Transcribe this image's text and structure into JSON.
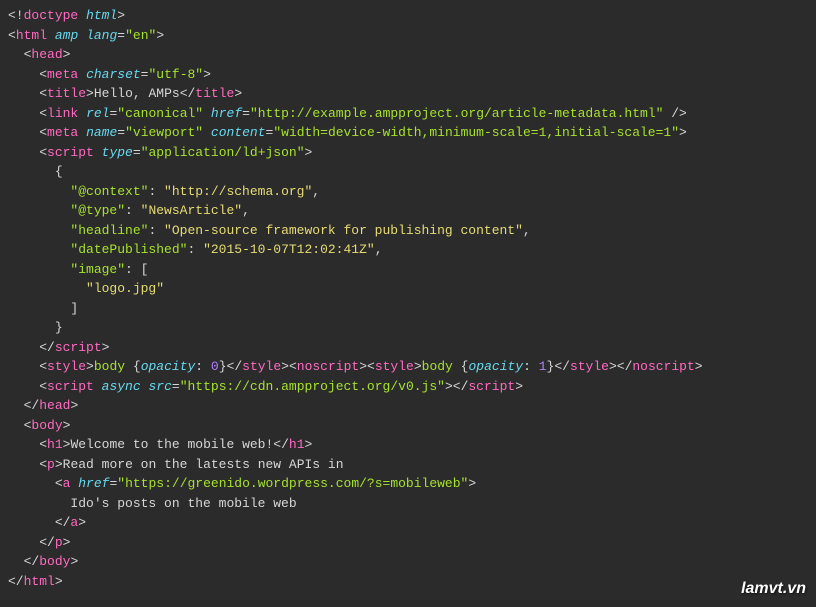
{
  "lines": [
    {
      "indent": 0,
      "segments": [
        {
          "t": "<!",
          "c": "tag-bracket"
        },
        {
          "t": "doctype",
          "c": "doctype"
        },
        {
          "t": " ",
          "c": "text-content"
        },
        {
          "t": "html",
          "c": "attr-name"
        },
        {
          "t": ">",
          "c": "tag-bracket"
        }
      ]
    },
    {
      "indent": 0,
      "segments": [
        {
          "t": "<",
          "c": "tag-bracket"
        },
        {
          "t": "html",
          "c": "tag-name"
        },
        {
          "t": " ",
          "c": "text-content"
        },
        {
          "t": "amp",
          "c": "attr-name"
        },
        {
          "t": " ",
          "c": "text-content"
        },
        {
          "t": "lang",
          "c": "attr-name"
        },
        {
          "t": "=",
          "c": "equals"
        },
        {
          "t": "\"en\"",
          "c": "attr-value"
        },
        {
          "t": ">",
          "c": "tag-bracket"
        }
      ]
    },
    {
      "indent": 1,
      "segments": [
        {
          "t": "<",
          "c": "tag-bracket"
        },
        {
          "t": "head",
          "c": "tag-name"
        },
        {
          "t": ">",
          "c": "tag-bracket"
        }
      ]
    },
    {
      "indent": 2,
      "segments": [
        {
          "t": "<",
          "c": "tag-bracket"
        },
        {
          "t": "meta",
          "c": "tag-name"
        },
        {
          "t": " ",
          "c": "text-content"
        },
        {
          "t": "charset",
          "c": "attr-name"
        },
        {
          "t": "=",
          "c": "equals"
        },
        {
          "t": "\"utf-8\"",
          "c": "attr-value"
        },
        {
          "t": ">",
          "c": "tag-bracket"
        }
      ]
    },
    {
      "indent": 2,
      "segments": [
        {
          "t": "<",
          "c": "tag-bracket"
        },
        {
          "t": "title",
          "c": "tag-name"
        },
        {
          "t": ">",
          "c": "tag-bracket"
        },
        {
          "t": "Hello, AMPs",
          "c": "text-content"
        },
        {
          "t": "</",
          "c": "tag-bracket"
        },
        {
          "t": "title",
          "c": "tag-name"
        },
        {
          "t": ">",
          "c": "tag-bracket"
        }
      ]
    },
    {
      "indent": 2,
      "segments": [
        {
          "t": "<",
          "c": "tag-bracket"
        },
        {
          "t": "link",
          "c": "tag-name"
        },
        {
          "t": " ",
          "c": "text-content"
        },
        {
          "t": "rel",
          "c": "attr-name"
        },
        {
          "t": "=",
          "c": "equals"
        },
        {
          "t": "\"canonical\"",
          "c": "attr-value"
        },
        {
          "t": " ",
          "c": "text-content"
        },
        {
          "t": "href",
          "c": "attr-name"
        },
        {
          "t": "=",
          "c": "equals"
        },
        {
          "t": "\"http://example.ampproject.org/article-metadata.html\"",
          "c": "attr-value"
        },
        {
          "t": " />",
          "c": "tag-bracket"
        }
      ]
    },
    {
      "indent": 2,
      "segments": [
        {
          "t": "<",
          "c": "tag-bracket"
        },
        {
          "t": "meta",
          "c": "tag-name"
        },
        {
          "t": " ",
          "c": "text-content"
        },
        {
          "t": "name",
          "c": "attr-name"
        },
        {
          "t": "=",
          "c": "equals"
        },
        {
          "t": "\"viewport\"",
          "c": "attr-value"
        },
        {
          "t": " ",
          "c": "text-content"
        },
        {
          "t": "content",
          "c": "attr-name"
        },
        {
          "t": "=",
          "c": "equals"
        },
        {
          "t": "\"width=device-width,minimum-scale=1,initial-scale=1\"",
          "c": "attr-value"
        },
        {
          "t": ">",
          "c": "tag-bracket"
        }
      ]
    },
    {
      "indent": 2,
      "segments": [
        {
          "t": "<",
          "c": "tag-bracket"
        },
        {
          "t": "script",
          "c": "tag-name"
        },
        {
          "t": " ",
          "c": "text-content"
        },
        {
          "t": "type",
          "c": "attr-name"
        },
        {
          "t": "=",
          "c": "equals"
        },
        {
          "t": "\"application/ld+json\"",
          "c": "attr-value"
        },
        {
          "t": ">",
          "c": "tag-bracket"
        }
      ]
    },
    {
      "indent": 3,
      "segments": [
        {
          "t": "{",
          "c": "json-punct"
        }
      ]
    },
    {
      "indent": 4,
      "segments": [
        {
          "t": "\"@context\"",
          "c": "json-key"
        },
        {
          "t": ": ",
          "c": "json-punct"
        },
        {
          "t": "\"http://schema.org\"",
          "c": "json-string"
        },
        {
          "t": ",",
          "c": "json-punct"
        }
      ]
    },
    {
      "indent": 4,
      "segments": [
        {
          "t": "\"@type\"",
          "c": "json-key"
        },
        {
          "t": ": ",
          "c": "json-punct"
        },
        {
          "t": "\"NewsArticle\"",
          "c": "json-string"
        },
        {
          "t": ",",
          "c": "json-punct"
        }
      ]
    },
    {
      "indent": 4,
      "segments": [
        {
          "t": "\"headline\"",
          "c": "json-key"
        },
        {
          "t": ": ",
          "c": "json-punct"
        },
        {
          "t": "\"Open-source framework for publishing content\"",
          "c": "json-string"
        },
        {
          "t": ",",
          "c": "json-punct"
        }
      ]
    },
    {
      "indent": 4,
      "segments": [
        {
          "t": "\"datePublished\"",
          "c": "json-key"
        },
        {
          "t": ": ",
          "c": "json-punct"
        },
        {
          "t": "\"2015-10-07T12:02:41Z\"",
          "c": "json-string"
        },
        {
          "t": ",",
          "c": "json-punct"
        }
      ]
    },
    {
      "indent": 4,
      "segments": [
        {
          "t": "\"image\"",
          "c": "json-key"
        },
        {
          "t": ": [",
          "c": "json-punct"
        }
      ]
    },
    {
      "indent": 5,
      "segments": [
        {
          "t": "\"logo.jpg\"",
          "c": "json-string"
        }
      ]
    },
    {
      "indent": 4,
      "segments": [
        {
          "t": "]",
          "c": "json-punct"
        }
      ]
    },
    {
      "indent": 3,
      "segments": [
        {
          "t": "}",
          "c": "json-punct"
        }
      ]
    },
    {
      "indent": 2,
      "segments": [
        {
          "t": "</",
          "c": "tag-bracket"
        },
        {
          "t": "script",
          "c": "tag-name"
        },
        {
          "t": ">",
          "c": "tag-bracket"
        }
      ]
    },
    {
      "indent": 2,
      "segments": [
        {
          "t": "<",
          "c": "tag-bracket"
        },
        {
          "t": "style",
          "c": "tag-name"
        },
        {
          "t": ">",
          "c": "tag-bracket"
        },
        {
          "t": "body ",
          "c": "css-selector"
        },
        {
          "t": "{",
          "c": "css-brace"
        },
        {
          "t": "opacity",
          "c": "css-prop"
        },
        {
          "t": ": ",
          "c": "css-value"
        },
        {
          "t": "0",
          "c": "css-num"
        },
        {
          "t": "}",
          "c": "css-brace"
        },
        {
          "t": "</",
          "c": "tag-bracket"
        },
        {
          "t": "style",
          "c": "tag-name"
        },
        {
          "t": ">",
          "c": "tag-bracket"
        },
        {
          "t": "<",
          "c": "tag-bracket"
        },
        {
          "t": "noscript",
          "c": "tag-name"
        },
        {
          "t": ">",
          "c": "tag-bracket"
        },
        {
          "t": "<",
          "c": "tag-bracket"
        },
        {
          "t": "style",
          "c": "tag-name"
        },
        {
          "t": ">",
          "c": "tag-bracket"
        },
        {
          "t": "body ",
          "c": "css-selector"
        },
        {
          "t": "{",
          "c": "css-brace"
        },
        {
          "t": "opacity",
          "c": "css-prop"
        },
        {
          "t": ": ",
          "c": "css-value"
        },
        {
          "t": "1",
          "c": "css-num"
        },
        {
          "t": "}",
          "c": "css-brace"
        },
        {
          "t": "</",
          "c": "tag-bracket"
        },
        {
          "t": "style",
          "c": "tag-name"
        },
        {
          "t": ">",
          "c": "tag-bracket"
        },
        {
          "t": "</",
          "c": "tag-bracket"
        },
        {
          "t": "noscript",
          "c": "tag-name"
        },
        {
          "t": ">",
          "c": "tag-bracket"
        }
      ]
    },
    {
      "indent": 2,
      "segments": [
        {
          "t": "<",
          "c": "tag-bracket"
        },
        {
          "t": "script",
          "c": "tag-name"
        },
        {
          "t": " ",
          "c": "text-content"
        },
        {
          "t": "async",
          "c": "attr-name"
        },
        {
          "t": " ",
          "c": "text-content"
        },
        {
          "t": "src",
          "c": "attr-name"
        },
        {
          "t": "=",
          "c": "equals"
        },
        {
          "t": "\"https://cdn.ampproject.org/v0.js\"",
          "c": "attr-value"
        },
        {
          "t": ">",
          "c": "tag-bracket"
        },
        {
          "t": "</",
          "c": "tag-bracket"
        },
        {
          "t": "script",
          "c": "tag-name"
        },
        {
          "t": ">",
          "c": "tag-bracket"
        }
      ]
    },
    {
      "indent": 1,
      "segments": [
        {
          "t": "</",
          "c": "tag-bracket"
        },
        {
          "t": "head",
          "c": "tag-name"
        },
        {
          "t": ">",
          "c": "tag-bracket"
        }
      ]
    },
    {
      "indent": 1,
      "segments": [
        {
          "t": "<",
          "c": "tag-bracket"
        },
        {
          "t": "body",
          "c": "tag-name"
        },
        {
          "t": ">",
          "c": "tag-bracket"
        }
      ]
    },
    {
      "indent": 2,
      "segments": [
        {
          "t": "<",
          "c": "tag-bracket"
        },
        {
          "t": "h1",
          "c": "tag-name"
        },
        {
          "t": ">",
          "c": "tag-bracket"
        },
        {
          "t": "Welcome to the mobile web!",
          "c": "text-content"
        },
        {
          "t": "</",
          "c": "tag-bracket"
        },
        {
          "t": "h1",
          "c": "tag-name"
        },
        {
          "t": ">",
          "c": "tag-bracket"
        }
      ]
    },
    {
      "indent": 2,
      "segments": [
        {
          "t": "<",
          "c": "tag-bracket"
        },
        {
          "t": "p",
          "c": "tag-name"
        },
        {
          "t": ">",
          "c": "tag-bracket"
        },
        {
          "t": "Read more on the latests new APIs in",
          "c": "text-content"
        }
      ]
    },
    {
      "indent": 3,
      "segments": [
        {
          "t": "<",
          "c": "tag-bracket"
        },
        {
          "t": "a",
          "c": "tag-name"
        },
        {
          "t": " ",
          "c": "text-content"
        },
        {
          "t": "href",
          "c": "attr-name"
        },
        {
          "t": "=",
          "c": "equals"
        },
        {
          "t": "\"https://greenido.wordpress.com/?s=mobileweb\"",
          "c": "attr-value"
        },
        {
          "t": ">",
          "c": "tag-bracket"
        }
      ]
    },
    {
      "indent": 4,
      "segments": [
        {
          "t": "Ido's posts on the mobile web",
          "c": "text-content"
        }
      ]
    },
    {
      "indent": 3,
      "segments": [
        {
          "t": "</",
          "c": "tag-bracket"
        },
        {
          "t": "a",
          "c": "tag-name"
        },
        {
          "t": ">",
          "c": "tag-bracket"
        }
      ]
    },
    {
      "indent": 2,
      "segments": [
        {
          "t": "</",
          "c": "tag-bracket"
        },
        {
          "t": "p",
          "c": "tag-name"
        },
        {
          "t": ">",
          "c": "tag-bracket"
        }
      ]
    },
    {
      "indent": 1,
      "segments": [
        {
          "t": "</",
          "c": "tag-bracket"
        },
        {
          "t": "body",
          "c": "tag-name"
        },
        {
          "t": ">",
          "c": "tag-bracket"
        }
      ]
    },
    {
      "indent": 0,
      "segments": [
        {
          "t": "</",
          "c": "tag-bracket"
        },
        {
          "t": "html",
          "c": "tag-name"
        },
        {
          "t": ">",
          "c": "tag-bracket"
        }
      ]
    }
  ],
  "watermark": "lamvt.vn"
}
